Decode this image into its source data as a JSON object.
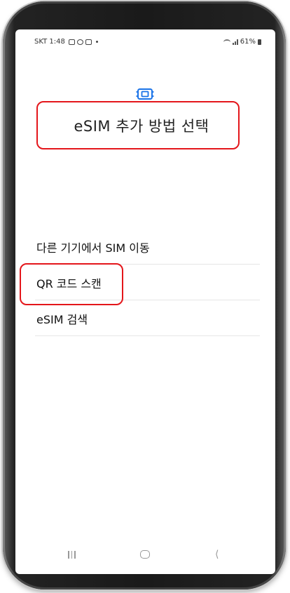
{
  "status_bar": {
    "carrier_time": "SKT 1:48",
    "battery": "61%"
  },
  "header": {
    "title": "eSIM 추가 방법 선택",
    "icon": "sim-card-icon",
    "accent_color": "#1a73e8"
  },
  "options": [
    {
      "label": "다른 기기에서 SIM 이동"
    },
    {
      "label": "QR 코드 스캔",
      "highlighted": true
    },
    {
      "label": "eSIM 검색"
    }
  ],
  "annotation_color": "#e4161b",
  "nav_bar": {
    "recent": "recent-apps-icon",
    "home": "home-icon",
    "back": "back-icon"
  }
}
